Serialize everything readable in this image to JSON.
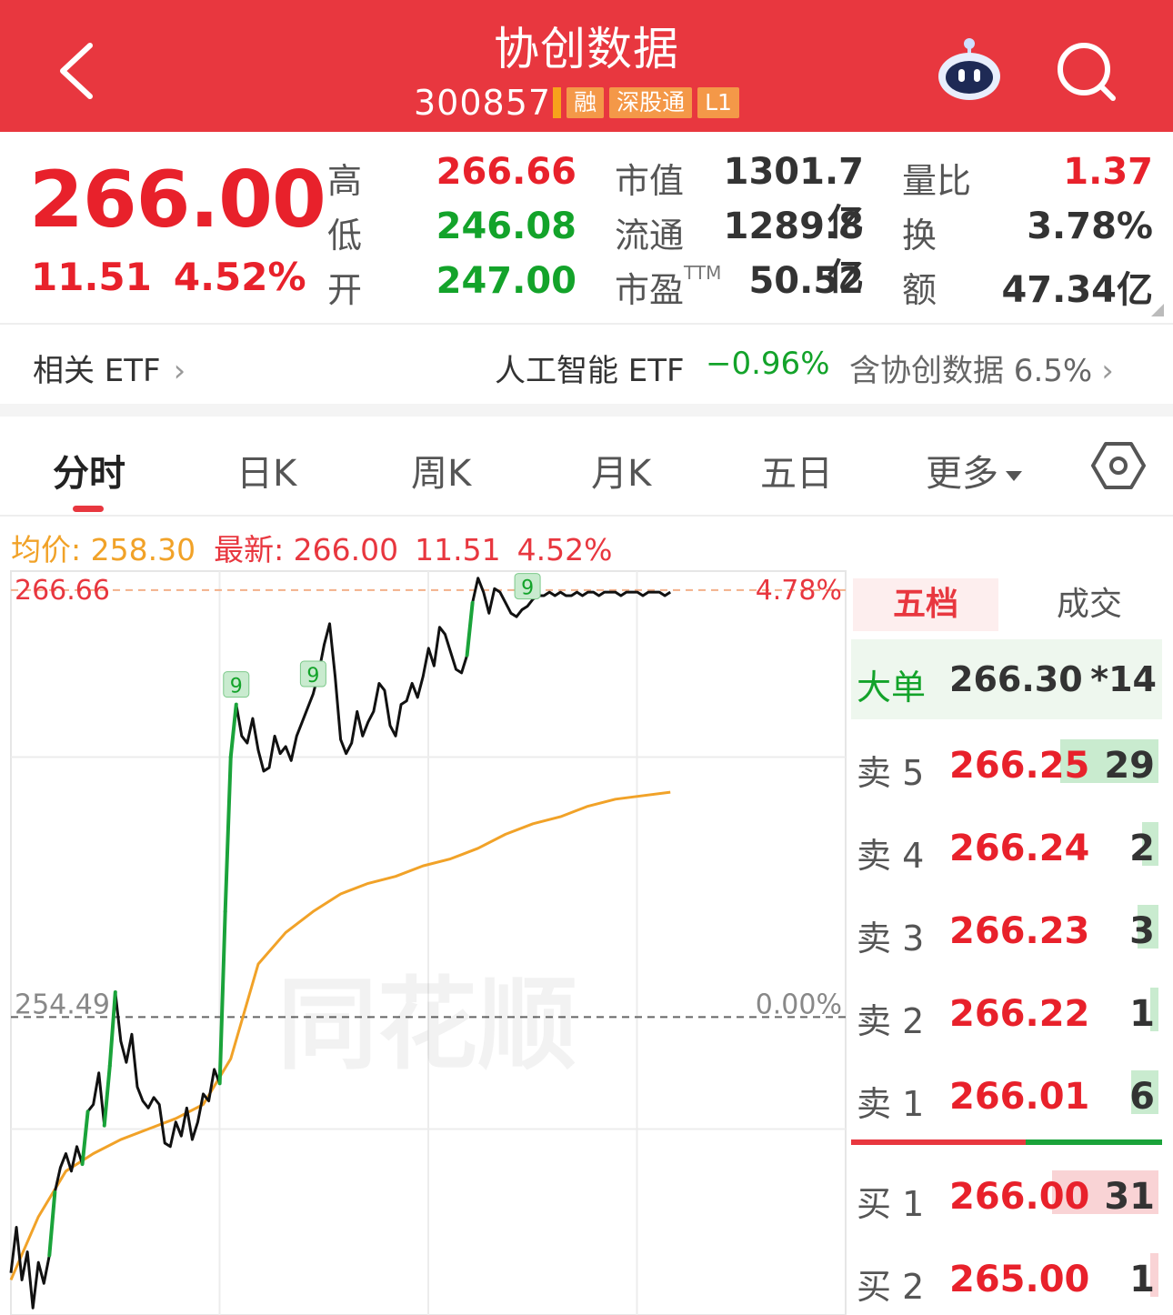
{
  "header": {
    "title": "协创数据",
    "code": "300857",
    "tags": [
      "融",
      "深股通",
      "L1"
    ],
    "icons": [
      "back-icon",
      "robot-assistant-icon",
      "search-icon"
    ]
  },
  "quote": {
    "price": "266.00",
    "change": "11.51",
    "change_pct": "4.52%",
    "high_label": "高",
    "high": "266.66",
    "low_label": "低",
    "low": "246.08",
    "open_label": "开",
    "open": "247.00",
    "mcap_label": "市值",
    "mcap": "1301.7亿",
    "float_label": "流通",
    "float": "1289.8亿",
    "pe_label": "市盈",
    "pe_sup": "TTM",
    "pe": "50.52",
    "vr_label": "量比",
    "vr": "1.37",
    "turnover_label": "换",
    "turnover": "3.78%",
    "amount_label": "额",
    "amount": "47.34亿"
  },
  "etf": {
    "label": "相关 ETF",
    "name": "人工智能 ETF",
    "pct": "−0.96%",
    "holding": "含协创数据 6.5%"
  },
  "tabs": {
    "items": [
      "分时",
      "日K",
      "周K",
      "月K",
      "五日"
    ],
    "more": "更多",
    "active": "分时"
  },
  "legend": {
    "avg_label": "均价: 258.30",
    "latest_label": "最新: 266.00",
    "latest_change": "11.51",
    "latest_pct": "4.52%"
  },
  "chart_data": {
    "type": "line",
    "y_top_label": "266.66",
    "y_top_pct": "4.78%",
    "y_ref_label": "254.49",
    "y_ref_pct": "0.00%",
    "ylim": [
      246.0,
      267.2
    ],
    "watermark": "同花顺",
    "signal_marker": "9",
    "series": [
      {
        "color": "#111111",
        "x": [
          0,
          2,
          4,
          6,
          8,
          10,
          12,
          14,
          16,
          18,
          20,
          22,
          24,
          26,
          28,
          30,
          32,
          34,
          36,
          38,
          40,
          42,
          44,
          46,
          48,
          50,
          52,
          54,
          56,
          58,
          60,
          62,
          64,
          66,
          68,
          70,
          72,
          74,
          76,
          78,
          80,
          82,
          84,
          86,
          88,
          90,
          92,
          94,
          96,
          98,
          100,
          102,
          104,
          106,
          108,
          110,
          112,
          114,
          116,
          118,
          120,
          122,
          124,
          126,
          128,
          130,
          132,
          134,
          136,
          138,
          140,
          142,
          144,
          146,
          148,
          150,
          152,
          154,
          156,
          158,
          160,
          162,
          164,
          166,
          168,
          170,
          172,
          174,
          176,
          178,
          180,
          182,
          184,
          186,
          188,
          190,
          192,
          194,
          196,
          198,
          200,
          202,
          204,
          206,
          208,
          210,
          212,
          214,
          216,
          218,
          220,
          222,
          224,
          226,
          228,
          230,
          232,
          234,
          236,
          238,
          240
        ],
        "values": [
          247.2,
          248.5,
          247.0,
          247.8,
          246.2,
          247.5,
          246.9,
          247.7,
          249.5,
          250.2,
          250.6,
          250.1,
          250.8,
          250.3,
          251.8,
          252.0,
          252.9,
          251.4,
          253.1,
          255.2,
          253.8,
          253.2,
          254.0,
          252.5,
          252.1,
          251.9,
          252.2,
          252.0,
          250.9,
          250.8,
          251.5,
          251.1,
          251.9,
          251.0,
          251.5,
          252.3,
          252.1,
          253.0,
          252.6,
          257.5,
          261.9,
          263.4,
          262.5,
          262.3,
          263.0,
          262.1,
          261.5,
          261.6,
          262.5,
          262.0,
          262.2,
          261.8,
          262.5,
          262.9,
          263.3,
          263.7,
          264.3,
          265.1,
          265.7,
          264.2,
          262.4,
          262.0,
          262.3,
          263.2,
          262.5,
          262.9,
          263.2,
          264.0,
          263.8,
          262.8,
          262.5,
          263.4,
          263.5,
          264.0,
          263.6,
          264.2,
          265.0,
          264.5,
          265.6,
          265.4,
          264.9,
          264.4,
          264.3,
          264.8,
          266.3,
          267.0,
          266.6,
          266.0,
          266.7,
          266.6,
          266.3,
          266.0,
          265.9,
          266.1,
          266.2,
          266.4,
          266.5,
          266.5,
          266.6,
          266.5,
          266.6,
          266.5,
          266.5,
          266.6,
          266.5,
          266.6,
          266.6,
          266.5,
          266.6,
          266.6,
          266.6,
          266.5,
          266.6,
          266.6,
          266.6,
          266.5,
          266.6,
          266.6,
          266.6,
          266.5,
          266.6
        ]
      },
      {
        "color": "#f1a228",
        "x": [
          0,
          10,
          20,
          30,
          40,
          50,
          60,
          70,
          80,
          90,
          100,
          110,
          120,
          130,
          140,
          150,
          160,
          170,
          180,
          190,
          200,
          210,
          220,
          230,
          240
        ],
        "values": [
          247.0,
          248.8,
          250.1,
          250.6,
          251.0,
          251.3,
          251.6,
          252.0,
          253.3,
          256.0,
          256.9,
          257.5,
          258.0,
          258.3,
          258.5,
          258.8,
          259.0,
          259.3,
          259.7,
          260.0,
          260.2,
          260.5,
          260.7,
          260.8,
          260.9
        ]
      }
    ]
  },
  "order_book": {
    "tabs": [
      "五档",
      "成交"
    ],
    "big_label": "大单",
    "big_price": "266.30",
    "big_vol": "*14",
    "asks": [
      {
        "label": "卖 5",
        "price": "266.25",
        "vol": "29",
        "bar": 0.72
      },
      {
        "label": "卖 4",
        "price": "266.24",
        "vol": "2",
        "bar": 0.12
      },
      {
        "label": "卖 3",
        "price": "266.23",
        "vol": "3",
        "bar": 0.15
      },
      {
        "label": "卖 2",
        "price": "266.22",
        "vol": "1",
        "bar": 0.06
      },
      {
        "label": "卖 1",
        "price": "266.01",
        "vol": "6",
        "bar": 0.2
      }
    ],
    "bids": [
      {
        "label": "买 1",
        "price": "266.00",
        "vol": "31",
        "bar": 0.78
      },
      {
        "label": "买 2",
        "price": "265.00",
        "vol": "1",
        "bar": 0.06
      }
    ]
  },
  "colors": {
    "brand_red": "#e8373f",
    "up_red": "#e8212b",
    "down_green": "#13a32a",
    "avg_orange": "#f1a228"
  }
}
